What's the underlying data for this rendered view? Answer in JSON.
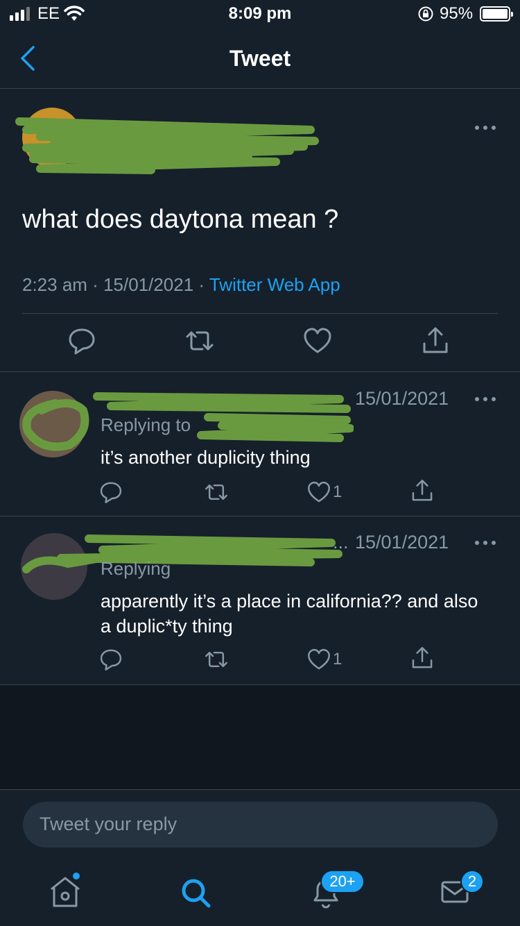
{
  "status_bar": {
    "carrier": "EE",
    "time": "8:09 pm",
    "battery": "95%"
  },
  "header": {
    "title": "Tweet"
  },
  "main_tweet": {
    "text": "what does daytona mean ?",
    "time": "2:23 am",
    "date": "15/01/2021",
    "source": "Twitter Web App"
  },
  "replies": [
    {
      "date": "15/01/2021",
      "replying_prefix": "Replying to",
      "text": "it’s another duplicity thing",
      "like_count": "1"
    },
    {
      "date": "15/01/2021",
      "name_truncation": "...",
      "replying_prefix": "Replying",
      "text": "apparently it’s a place in california?? and also a duplic*ty thing",
      "like_count": "1"
    }
  ],
  "composer": {
    "placeholder": "Tweet your reply"
  },
  "tab_bar": {
    "notifications_badge": "20+",
    "messages_badge": "2"
  },
  "colors": {
    "background": "#15202b",
    "accent": "#1da1f2",
    "secondary_text": "#8899a6",
    "redaction": "#6a9a40"
  }
}
